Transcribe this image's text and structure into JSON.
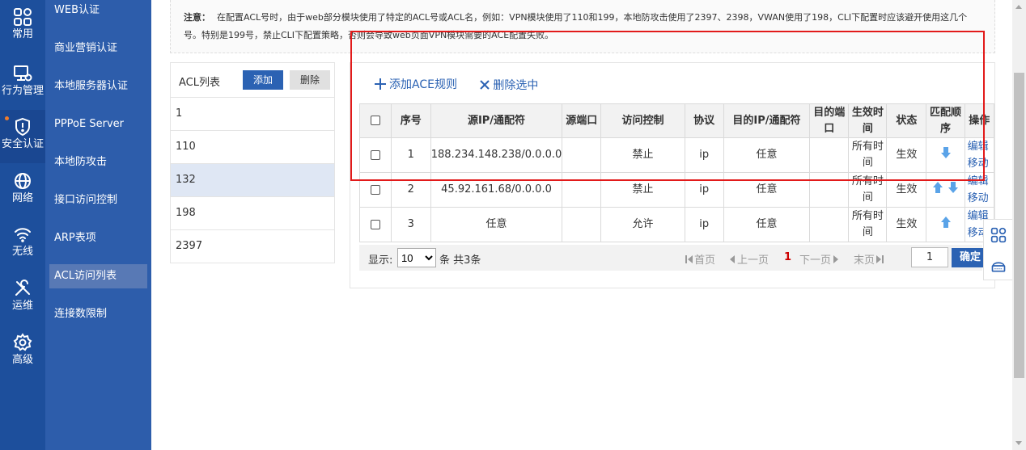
{
  "rail": {
    "items": [
      {
        "label": "常用",
        "icon": "grid-icon"
      },
      {
        "label": "行为管理",
        "icon": "monitor-icon"
      },
      {
        "label": "安全认证",
        "icon": "shield-icon"
      },
      {
        "label": "网络",
        "icon": "globe-icon"
      },
      {
        "label": "无线",
        "icon": "wifi-icon"
      },
      {
        "label": "运维",
        "icon": "tools-icon"
      },
      {
        "label": "高级",
        "icon": "gear-icon"
      }
    ],
    "active": "安全认证"
  },
  "submenu": {
    "items": [
      "WEB认证",
      "商业营销认证",
      "本地服务器认证",
      "PPPoE Server",
      "本地防攻击",
      "接口访问控制",
      "ARP表项",
      "ACL访问列表",
      "连接数限制"
    ],
    "active": "ACL访问列表"
  },
  "notice": {
    "label": "注意：",
    "text": "在配置ACL号时，由于web部分模块使用了特定的ACL号或ACL名，例如：VPN模块使用了110和199，本地防攻击使用了2397、2398，VWAN使用了198，CLI下配置时应该避开使用这几个号。特别是199号，禁止CLI下配置策略，否则会导致web页面VPN模块需要的ACE配置失败。"
  },
  "acl": {
    "title": "ACL列表",
    "add_label": "添加",
    "delete_label": "删除",
    "items": [
      "1",
      "110",
      "132",
      "198",
      "2397"
    ],
    "selected": "132"
  },
  "ace": {
    "add_rule_label": "添加ACE规则",
    "delete_selected_label": "删除选中",
    "headers": {
      "seq": "序号",
      "src": "源IP/通配符",
      "src_port": "源端口",
      "access": "访问控制",
      "proto": "协议",
      "dst": "目的IP/通配符",
      "dst_port": "目的端口",
      "time": "生效时间",
      "status": "状态",
      "order": "匹配顺序",
      "ops": "操作"
    },
    "rows": [
      {
        "seq": "1",
        "src": "188.234.148.238/0.0.0.0",
        "src_port": "",
        "access": "禁止",
        "proto": "ip",
        "dst": "任意",
        "dst_port": "",
        "time": "所有时间",
        "status": "生效",
        "edit": "编辑",
        "move": "移动",
        "arrows": "down"
      },
      {
        "seq": "2",
        "src": "45.92.161.68/0.0.0.0",
        "src_port": "",
        "access": "禁止",
        "proto": "ip",
        "dst": "任意",
        "dst_port": "",
        "time": "所有时间",
        "status": "生效",
        "edit": "编辑",
        "move": "移动",
        "arrows": "both"
      },
      {
        "seq": "3",
        "src": "任意",
        "src_port": "",
        "access": "允许",
        "proto": "ip",
        "dst": "任意",
        "dst_port": "",
        "time": "所有时间",
        "status": "生效",
        "edit": "编辑",
        "move": "移动",
        "arrows": "up"
      }
    ]
  },
  "pager": {
    "show_label": "显示:",
    "page_size": "10",
    "page_size_options": [
      "10"
    ],
    "unit_total": "条 共3条",
    "first": "首页",
    "prev": "上一页",
    "current": "1",
    "next": "下一页",
    "last": "末页",
    "goto_value": "1",
    "confirm": "确定"
  },
  "colors": {
    "rail_bg": "#1d4f9c",
    "submenu_bg": "#2d5dab",
    "accent": "#2b62b3",
    "highlight_box": "#e21a1a"
  }
}
